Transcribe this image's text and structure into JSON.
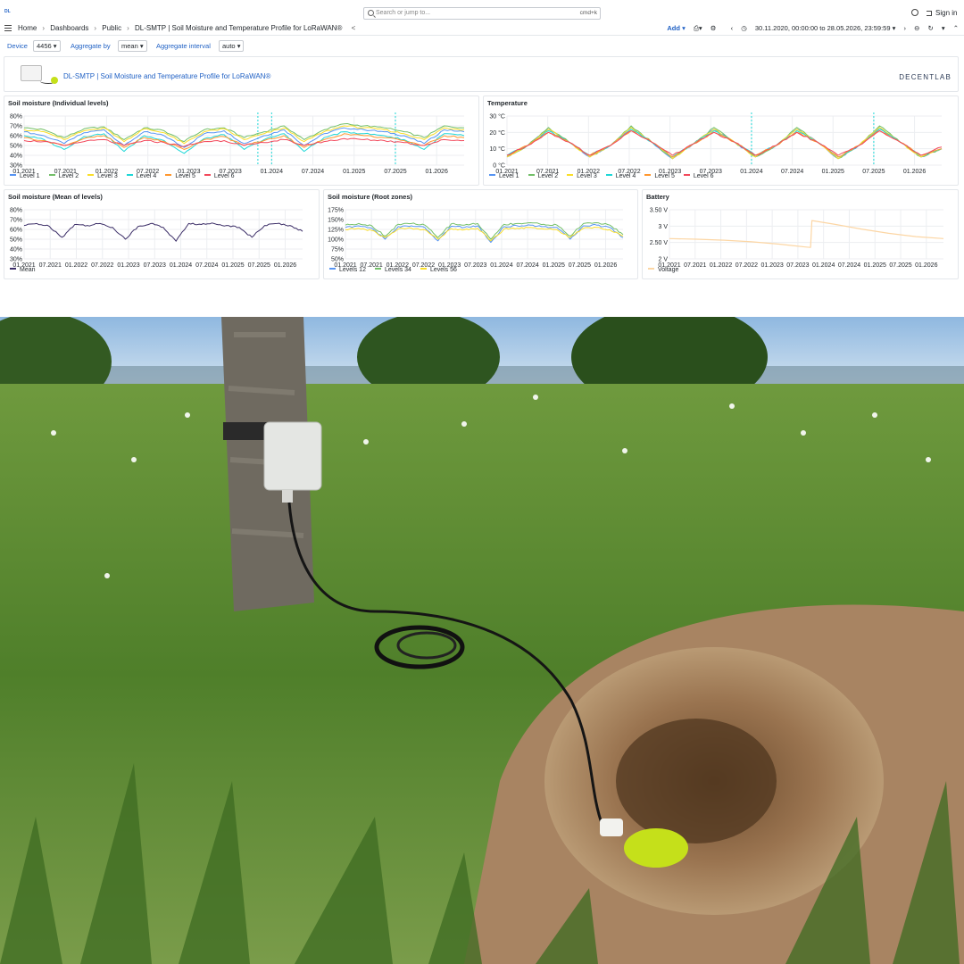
{
  "nav": {
    "logo": "DL",
    "search_placeholder": "Search or jump to...",
    "search_shortcut": "cmd+k",
    "sign_in": "Sign in"
  },
  "breadcrumb": [
    "Home",
    "Dashboards",
    "Public",
    "DL-SMTP | Soil Moisture and Temperature Profile for LoRaWAN®"
  ],
  "toolbar": {
    "add": "Add",
    "time_range": "30.11.2020, 00:00:00 to 28.05.2026, 23:59:59"
  },
  "variables": [
    {
      "label": "Device",
      "value": "4456"
    },
    {
      "label": "Aggregate by",
      "value": "mean"
    },
    {
      "label": "Aggregate interval",
      "value": "auto"
    }
  ],
  "header_panel": {
    "title": "DL-SMTP | Soil Moisture and Temperature Profile for LoRaWAN®",
    "brand": "DECENTLAB"
  },
  "colors": {
    "accent": "#1f60c4",
    "green": "#73bf69",
    "yellow": "#fade2a",
    "blue": "#5794f2",
    "orange": "#ff9830",
    "red": "#f2495c",
    "purple": "#3b2d67",
    "cyan": "#1fd7d7",
    "voltage": "#fcd6a4",
    "grid": "#eceef1"
  },
  "chart_data": [
    {
      "id": "moisture_levels",
      "type": "line",
      "title": "Soil moisture (Individual levels)",
      "yticks": [
        "80%",
        "70%",
        "60%",
        "50%",
        "40%",
        "30%"
      ],
      "ylim": [
        30,
        80
      ],
      "xticks": [
        "01.2021",
        "07.2021",
        "01.2022",
        "07.2022",
        "01.2023",
        "07.2023",
        "01.2024",
        "07.2024",
        "01.2025",
        "07.2025",
        "01.2026"
      ],
      "xrange": [
        "01.2021",
        "05.2026"
      ],
      "series": [
        {
          "name": "Level 1",
          "color": "blue",
          "values": [
            64,
            60,
            52,
            63,
            66,
            50,
            64,
            60,
            48,
            62,
            65,
            52,
            60,
            66,
            50,
            62,
            68,
            66,
            64,
            60,
            52,
            66,
            64
          ]
        },
        {
          "name": "Level 2",
          "color": "green",
          "values": [
            68,
            66,
            58,
            67,
            69,
            56,
            68,
            65,
            54,
            66,
            68,
            58,
            64,
            70,
            56,
            66,
            72,
            70,
            68,
            64,
            58,
            70,
            68
          ]
        },
        {
          "name": "Level 3",
          "color": "yellow",
          "values": [
            66,
            64,
            56,
            65,
            68,
            54,
            67,
            63,
            52,
            64,
            67,
            56,
            62,
            68,
            54,
            64,
            70,
            68,
            66,
            62,
            56,
            68,
            66
          ]
        },
        {
          "name": "Level 4",
          "color": "cyan",
          "values": [
            60,
            56,
            46,
            59,
            62,
            44,
            60,
            55,
            42,
            57,
            61,
            46,
            56,
            62,
            44,
            58,
            64,
            62,
            60,
            56,
            46,
            62,
            60
          ]
        },
        {
          "name": "Level 5",
          "color": "orange",
          "values": [
            58,
            55,
            50,
            57,
            60,
            48,
            58,
            54,
            46,
            56,
            59,
            50,
            55,
            60,
            48,
            56,
            62,
            60,
            58,
            55,
            50,
            60,
            58
          ]
        },
        {
          "name": "Level 6",
          "color": "red",
          "values": [
            55,
            54,
            50,
            54,
            56,
            50,
            55,
            53,
            49,
            54,
            55,
            50,
            53,
            56,
            50,
            54,
            57,
            56,
            55,
            53,
            50,
            56,
            55
          ]
        }
      ],
      "annotations": [
        "11.2023",
        "01.2024",
        "07.2025"
      ]
    },
    {
      "id": "temperature",
      "type": "line",
      "title": "Temperature",
      "yticks": [
        "30 °C",
        "20 °C",
        "10 °C",
        "0 °C"
      ],
      "ylim": [
        0,
        30
      ],
      "xticks": [
        "01.2021",
        "07.2021",
        "01.2022",
        "07.2022",
        "01.2023",
        "07.2023",
        "01.2024",
        "07.2024",
        "01.2025",
        "07.2025",
        "01.2026"
      ],
      "xrange": [
        "01.2021",
        "05.2026"
      ],
      "series": [
        {
          "name": "Level 1",
          "color": "blue",
          "values": [
            5,
            12,
            22,
            14,
            5,
            12,
            23,
            14,
            4,
            13,
            22,
            14,
            5,
            12,
            22,
            14,
            4,
            12,
            23,
            14,
            5,
            10
          ]
        },
        {
          "name": "Level 2",
          "color": "green",
          "values": [
            5,
            12,
            23,
            14,
            5,
            12,
            24,
            14,
            4,
            13,
            23,
            14,
            5,
            12,
            23,
            14,
            4,
            12,
            24,
            14,
            5,
            10
          ]
        },
        {
          "name": "Level 3",
          "color": "yellow",
          "values": [
            5,
            12,
            22,
            14,
            5,
            12,
            23,
            14,
            4,
            13,
            22,
            14,
            5,
            12,
            22,
            14,
            4,
            12,
            23,
            14,
            5,
            10
          ]
        },
        {
          "name": "Level 4",
          "color": "cyan",
          "values": [
            6,
            12,
            21,
            14,
            6,
            12,
            22,
            14,
            5,
            13,
            21,
            14,
            6,
            12,
            21,
            14,
            5,
            12,
            22,
            14,
            6,
            10
          ]
        },
        {
          "name": "Level 5",
          "color": "orange",
          "values": [
            6,
            12,
            20,
            14,
            6,
            12,
            21,
            14,
            5,
            13,
            20,
            14,
            6,
            12,
            20,
            14,
            5,
            12,
            21,
            14,
            6,
            10
          ]
        },
        {
          "name": "Level 6",
          "color": "red",
          "values": [
            6,
            12,
            20,
            14,
            6,
            12,
            21,
            14,
            6,
            13,
            20,
            14,
            6,
            12,
            20,
            14,
            6,
            12,
            21,
            14,
            6,
            11
          ]
        }
      ],
      "annotations": [
        "01.2024",
        "07.2025"
      ]
    },
    {
      "id": "moisture_mean",
      "type": "line",
      "title": "Soil moisture (Mean of levels)",
      "yticks": [
        "80%",
        "70%",
        "60%",
        "50%",
        "40%",
        "30%"
      ],
      "ylim": [
        30,
        80
      ],
      "xticks": [
        "01.2021",
        "07.2021",
        "01.2022",
        "07.2022",
        "01.2023",
        "07.2023",
        "01.2024",
        "07.2024",
        "01.2025",
        "07.2025",
        "01.2026"
      ],
      "xrange": [
        "01.2021",
        "05.2026"
      ],
      "series": [
        {
          "name": "Mean",
          "color": "purple",
          "values": [
            64,
            66,
            63,
            52,
            65,
            64,
            66,
            62,
            50,
            63,
            66,
            62,
            48,
            66,
            65,
            66,
            64,
            62,
            52,
            64,
            66,
            64,
            58
          ]
        }
      ]
    },
    {
      "id": "moisture_root",
      "type": "line",
      "title": "Soil moisture (Root zones)",
      "yticks": [
        "175%",
        "150%",
        "125%",
        "100%",
        "75%",
        "50%"
      ],
      "ylim": [
        50,
        175
      ],
      "xticks": [
        "01.2021",
        "07.2021",
        "01.2022",
        "07.2022",
        "01.2023",
        "07.2023",
        "01.2024",
        "07.2024",
        "01.2025",
        "07.2025",
        "01.2026"
      ],
      "xrange": [
        "01.2021",
        "05.2026"
      ],
      "series": [
        {
          "name": "Levels 12",
          "color": "blue",
          "values": [
            130,
            134,
            128,
            100,
            132,
            134,
            130,
            96,
            133,
            130,
            134,
            92,
            132,
            134,
            136,
            132,
            130,
            100,
            134,
            136,
            130,
            104
          ]
        },
        {
          "name": "Levels 34",
          "color": "green",
          "values": [
            136,
            140,
            134,
            108,
            138,
            140,
            136,
            104,
            139,
            136,
            140,
            100,
            138,
            140,
            142,
            138,
            136,
            108,
            140,
            142,
            136,
            112
          ]
        },
        {
          "name": "Levels 56",
          "color": "yellow",
          "values": [
            124,
            128,
            122,
            104,
            126,
            128,
            124,
            100,
            127,
            124,
            128,
            96,
            126,
            128,
            130,
            126,
            124,
            104,
            128,
            130,
            124,
            108
          ]
        }
      ]
    },
    {
      "id": "battery",
      "type": "line",
      "title": "Battery",
      "yticks": [
        "3.50 V",
        "3 V",
        "2.50 V",
        "2 V"
      ],
      "ylim": [
        2,
        3.5
      ],
      "xticks": [
        "01.2021",
        "07.2021",
        "01.2022",
        "07.2022",
        "01.2023",
        "07.2023",
        "01.2024",
        "07.2024",
        "01.2025",
        "07.2025",
        "01.2026"
      ],
      "xrange": [
        "01.2021",
        "05.2026"
      ],
      "series": [
        {
          "name": "Voltage",
          "color": "voltage",
          "x": [
            0,
            0.1,
            0.2,
            0.3,
            0.4,
            0.5,
            0.515,
            0.52,
            0.6,
            0.7,
            0.8,
            0.9,
            1.0
          ],
          "values": [
            2.62,
            2.6,
            2.57,
            2.52,
            2.45,
            2.36,
            2.35,
            3.17,
            3.06,
            2.91,
            2.78,
            2.68,
            2.62
          ]
        }
      ]
    }
  ]
}
